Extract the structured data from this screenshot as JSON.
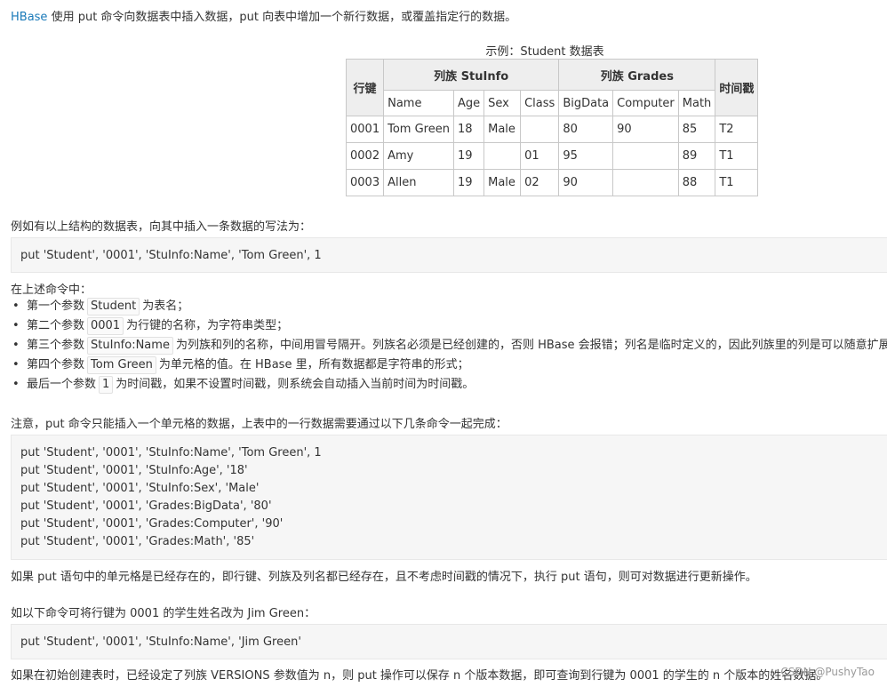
{
  "intro": {
    "link": "HBase",
    "text": " 使用 put 命令向数据表中插入数据，put 向表中增加一个新行数据，或覆盖指定行的数据。"
  },
  "table": {
    "caption": "示例：Student 数据表",
    "rowkey_header": "行键",
    "family1": "列族 StuInfo",
    "family2": "列族 Grades",
    "timestamp_header": "时间戳",
    "columns": [
      "Name",
      "Age",
      "Sex",
      "Class",
      "BigData",
      "Computer",
      "Math"
    ],
    "rows": [
      [
        "0001",
        "Tom Green",
        "18",
        "Male",
        "",
        "80",
        "90",
        "85",
        "T2"
      ],
      [
        "0002",
        "Amy",
        "19",
        "",
        "01",
        "95",
        "",
        "89",
        "T1"
      ],
      [
        "0003",
        "Allen",
        "19",
        "Male",
        "02",
        "90",
        "",
        "88",
        "T1"
      ]
    ]
  },
  "example_intro": "例如有以上结构的数据表，向其中插入一条数据的写法为：",
  "example_code": "put 'Student', '0001', 'StuInfo:Name', 'Tom Green', 1",
  "params_intro": "在上述命令中：",
  "params": [
    {
      "pre": "第一个参数",
      "chip": "Student",
      "post": "为表名；"
    },
    {
      "pre": "第二个参数",
      "chip": "0001",
      "post": "为行键的名称，为字符串类型；"
    },
    {
      "pre": "第三个参数",
      "chip": "StuInfo:Name",
      "post": "为列族和列的名称，中间用冒号隔开。列族名必须是已经创建的，否则 HBase 会报错；列名是临时定义的，因此列族里的列是可以随意扩展的；"
    },
    {
      "pre": "第四个参数",
      "chip": "Tom Green",
      "post": "为单元格的值。在 HBase 里，所有数据都是字符串的形式；"
    },
    {
      "pre": "最后一个参数",
      "chip": "1",
      "post": "为时间戳，如果不设置时间戳，则系统会自动插入当前时间为时间戳。"
    }
  ],
  "note": "注意，put 命令只能插入一个单元格的数据，上表中的一行数据需要通过以下几条命令一起完成：",
  "multi_code": [
    "put 'Student', '0001', 'StuInfo:Name', 'Tom Green', 1",
    "put 'Student', '0001', 'StuInfo:Age', '18'",
    "put 'Student', '0001', 'StuInfo:Sex', 'Male'",
    "put 'Student', '0001', 'Grades:BigData', '80'",
    "put 'Student', '0001', 'Grades:Computer', '90'",
    "put 'Student', '0001', 'Grades:Math', '85'"
  ],
  "update_text": "如果 put 语句中的单元格是已经存在的，即行键、列族及列名都已经存在，且不考虑时间戳的情况下，执行 put 语句，则可对数据进行更新操作。",
  "rename_intro": "如以下命令可将行键为 0001 的学生姓名改为 Jim Green：",
  "rename_code": "put 'Student', '0001', 'StuInfo:Name', 'Jim Green'",
  "versions_text": "如果在初始创建表时，已经设定了列族 VERSIONS 参数值为 n，则 put 操作可以保存 n 个版本数据，即可查询到行键为 0001 的学生的 n 个版本的姓名数据。",
  "watermark": "CSDN @PushyTao"
}
